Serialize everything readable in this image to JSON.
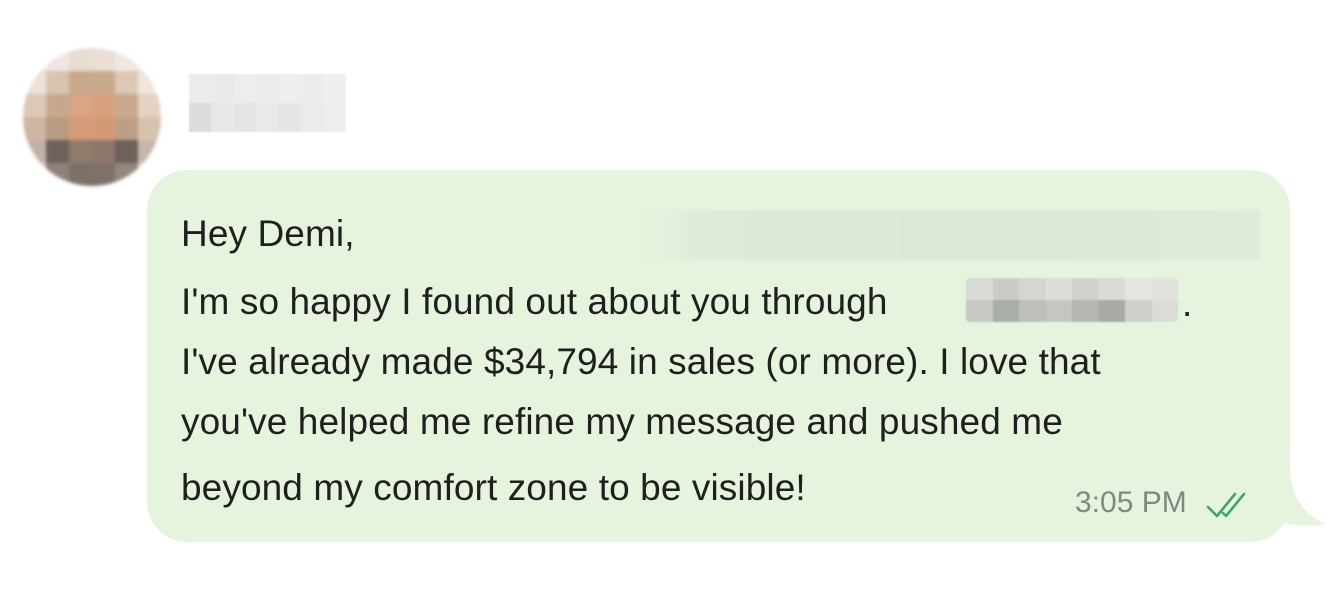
{
  "chat": {
    "sender": {
      "name_redacted": true,
      "avatar_redacted": true
    },
    "message": {
      "lines": [
        "Hey Demi,",
        "I'm so happy I found out about you through",
        "I've already made $34,794 in sales (or more). I love that",
        "you've helped me refine my message and pushed me",
        "beyond my comfort zone to be visible!"
      ],
      "trailing_punctuation": ".",
      "timestamp": "3:05 PM",
      "status_icon": "double-check-icon"
    },
    "colors": {
      "bubble_background": "#e6f4dd",
      "text": "#1f1f1f",
      "timestamp": "#7d8a83",
      "read_check": "#3fa66b"
    }
  }
}
